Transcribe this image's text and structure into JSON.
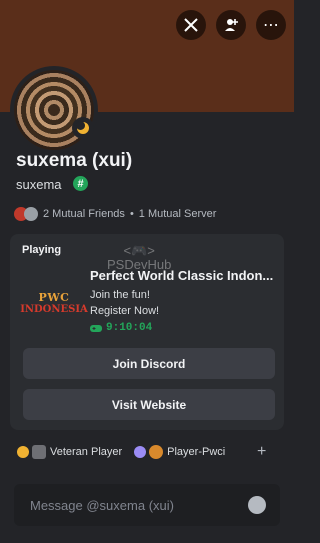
{
  "profile": {
    "display_name": "suxema (xui)",
    "username": "suxema",
    "tag_glyph": "#",
    "status": "idle",
    "banner_color": "#5a2e1a"
  },
  "header_actions": [
    {
      "icon": "swords-icon"
    },
    {
      "icon": "add-friend-icon"
    },
    {
      "label": "⋯",
      "icon": "more-icon"
    }
  ],
  "mutual": {
    "friends": "2 Mutual Friends",
    "separator": "•",
    "servers": "1 Mutual Server"
  },
  "activity": {
    "heading": "Playing",
    "game_art_line1": "PWC",
    "game_art_line2": "INDONESIA",
    "title": "Perfect World Classic Indon...",
    "details": "Join the fun!",
    "state": "Register Now!",
    "elapsed": "9:10:04",
    "buttons": [
      "Join Discord",
      "Visit Website"
    ],
    "watermark": "PSDevHub"
  },
  "badges": [
    {
      "label": "Veteran Player",
      "color": "#f0b232"
    },
    {
      "label": "Player-Pwci",
      "color": "#9b8cf5"
    }
  ],
  "add_label": "+",
  "message": {
    "placeholder": "Message @suxema (xui)"
  },
  "colors": {
    "background": "#232428",
    "card": "#2b2d31",
    "accent_green": "#23a55a",
    "button": "#3c3e45"
  }
}
